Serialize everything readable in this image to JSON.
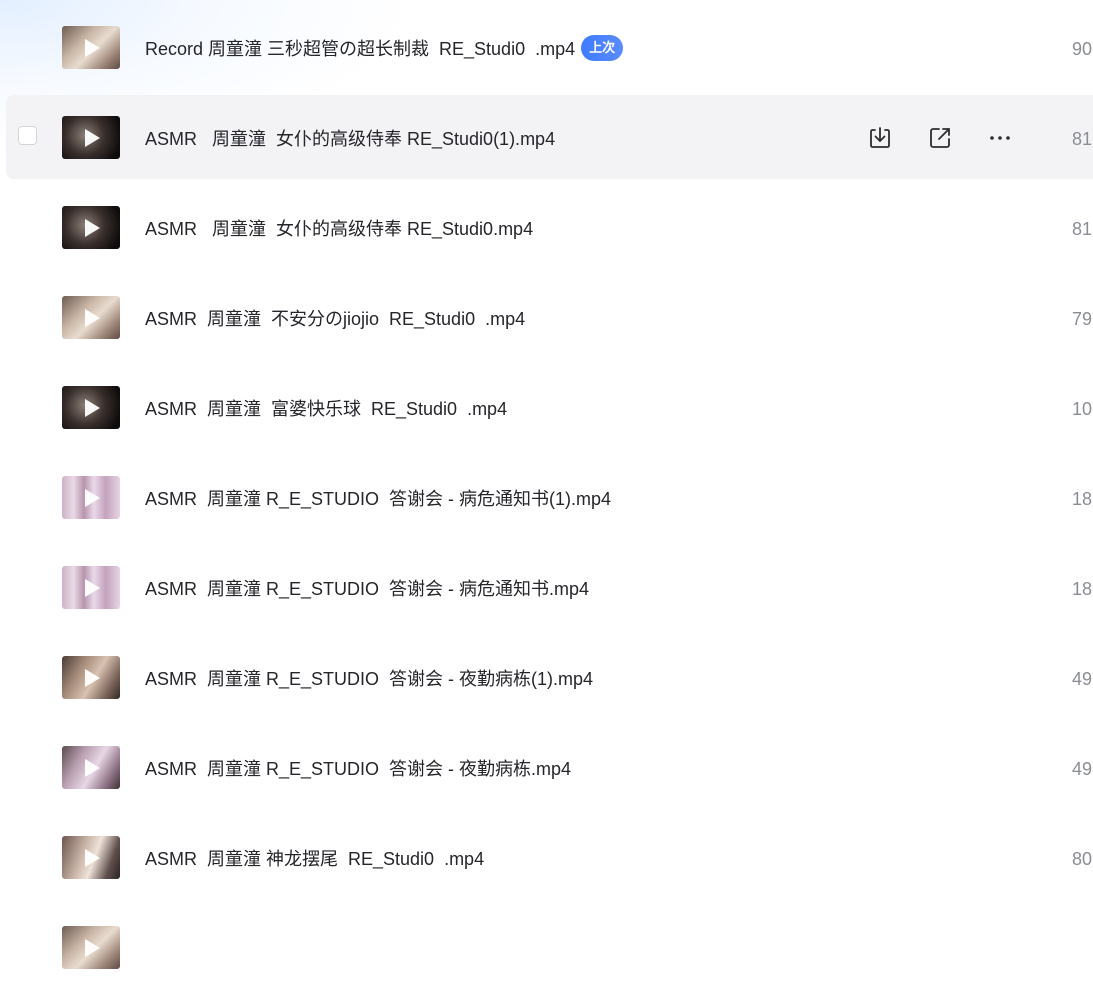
{
  "files": [
    {
      "name": "Record 周童潼 三秒超管の超长制裁  RE_Studi0  .mp4",
      "badge": "上次",
      "size": "90",
      "thumb": "warm"
    },
    {
      "name": "ASMR   周童潼  女仆的高级侍奉 RE_Studi0(1).mp4",
      "badge": "",
      "size": "81",
      "thumb": "dark",
      "hovered": true
    },
    {
      "name": "ASMR   周童潼  女仆的高级侍奉 RE_Studi0.mp4",
      "badge": "",
      "size": "81",
      "thumb": "dark"
    },
    {
      "name": "ASMR  周童潼  不安分のjiojio  RE_Studi0  .mp4",
      "badge": "",
      "size": "79",
      "thumb": "warm"
    },
    {
      "name": "ASMR  周童潼  富婆快乐球  RE_Studi0  .mp4",
      "badge": "",
      "size": "10",
      "thumb": "dark"
    },
    {
      "name": "ASMR  周童潼 R_E_STUDIO  答谢会 - 病危通知书(1).mp4",
      "badge": "",
      "size": "18",
      "thumb": "pink"
    },
    {
      "name": "ASMR  周童潼 R_E_STUDIO  答谢会 - 病危通知书.mp4",
      "badge": "",
      "size": "18",
      "thumb": "pink"
    },
    {
      "name": "ASMR  周童潼 R_E_STUDIO  答谢会 - 夜勤病栋(1).mp4",
      "badge": "",
      "size": "49",
      "thumb": "warm2"
    },
    {
      "name": "ASMR  周童潼 R_E_STUDIO  答谢会 - 夜勤病栋.mp4",
      "badge": "",
      "size": "49",
      "thumb": "lilac"
    },
    {
      "name": "ASMR  周童潼 神龙摆尾  RE_Studi0  .mp4",
      "badge": "",
      "size": "80",
      "thumb": "dusk"
    },
    {
      "name": "",
      "badge": "",
      "size": "",
      "thumb": "warm"
    }
  ],
  "actions": {
    "download_icon": "download-icon",
    "share_icon": "share-icon",
    "more_icon": "more-icon"
  },
  "colors": {
    "badge": "#3d7bff",
    "hover_row": "#f3f3f5",
    "size_text": "#8a8d94"
  }
}
